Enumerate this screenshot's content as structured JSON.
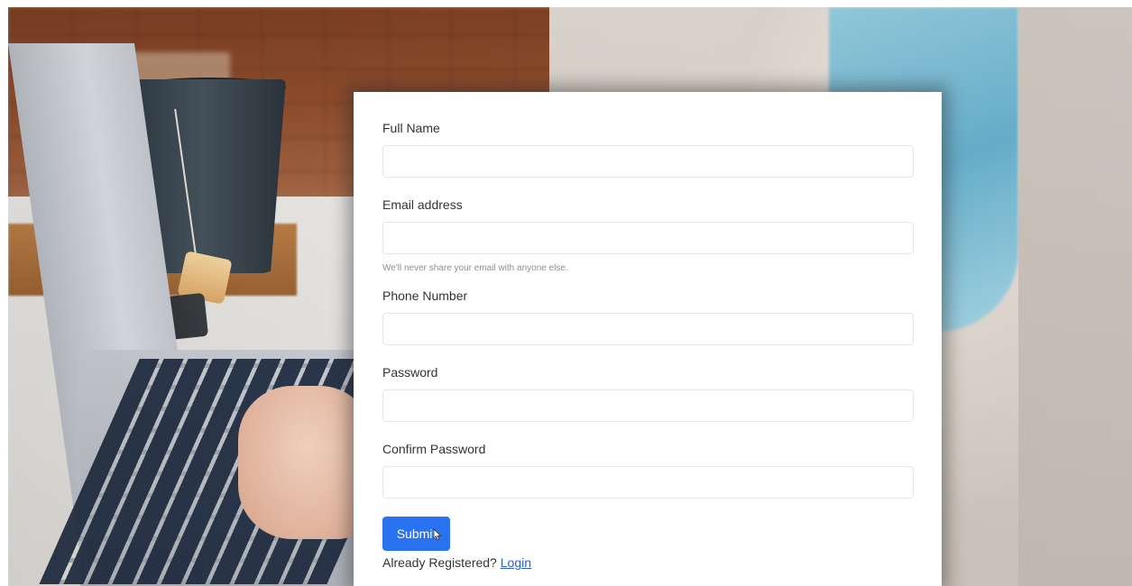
{
  "form": {
    "fields": [
      {
        "label": "Full Name",
        "value": "",
        "placeholder": ""
      },
      {
        "label": "Email address",
        "value": "",
        "placeholder": ""
      },
      {
        "label": "Phone Number",
        "value": "",
        "placeholder": ""
      },
      {
        "label": "Password",
        "value": "",
        "placeholder": ""
      },
      {
        "label": "Confirm Password",
        "value": "",
        "placeholder": ""
      }
    ],
    "email_help": "We'll never share your email with anyone else.",
    "submit_label": "Submit",
    "already_text": "Already Registered?",
    "login_label": "Login"
  },
  "colors": {
    "primary": "#2a73f0",
    "link": "#2a62c9",
    "card_bg": "#ffffff"
  }
}
